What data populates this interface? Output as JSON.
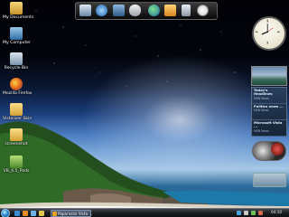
{
  "desktop_icons": [
    {
      "label": "My Documents",
      "icon": "folder-documents-icon"
    },
    {
      "label": "My Computer",
      "icon": "computer-icon"
    },
    {
      "label": "Recycle Bin",
      "icon": "recycle-bin-icon"
    },
    {
      "label": "Mozilla Firefox",
      "icon": "firefox-icon"
    },
    {
      "label": "Vistalizer Skin",
      "icon": "folder-icon"
    },
    {
      "label": "screenshot",
      "icon": "folder-icon"
    },
    {
      "label": "VB_4.5_Pods",
      "icon": "installer-icon"
    }
  ],
  "dock_items": [
    "monitor-icon",
    "globe-icon",
    "photo-icon",
    "cloud-icon",
    "earth-icon",
    "media-player-icon",
    "trash-icon",
    "clock-icon"
  ],
  "feeds": [
    {
      "title": "Today's Headlines",
      "source": "MSN News"
    },
    {
      "title": "Politics news ...",
      "source": "MSN News"
    },
    {
      "title": "Microsoft Vista ...",
      "source": "MSN News"
    }
  ],
  "taskbar": {
    "task_label": "Paparazzo Vista ...",
    "time": "04:10"
  },
  "colors": {
    "taskbar": "#1e2024",
    "accent": "#2a8bd0"
  }
}
